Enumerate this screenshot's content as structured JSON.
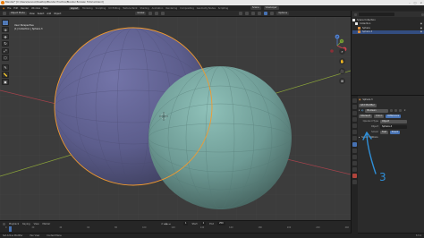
{
  "window": {
    "title": "Blender* [C:\\Users\\Lenovo\\Desktop\\Blender Practice\\Blender Boolean Tutorial.blend]",
    "controls": [
      "–",
      "□",
      "×"
    ]
  },
  "top_menu": {
    "items": [
      "File",
      "Edit",
      "Render",
      "Window",
      "Help"
    ],
    "workspaces": [
      "Layout",
      "Modeling",
      "Sculpting",
      "UV Editing",
      "Texture Paint",
      "Shading",
      "Animation",
      "Rendering",
      "Compositing",
      "Geometry Nodes",
      "Scripting"
    ],
    "active_workspace": "Layout",
    "scene": "Scene",
    "view_layer": "ViewLayer"
  },
  "viewport_header": {
    "mode": "Object Mode",
    "menus": [
      "View",
      "Select",
      "Add",
      "Object"
    ],
    "transform": "Global",
    "options": "Options"
  },
  "viewport": {
    "info_line1": "User Perspective",
    "info_line2": "(1) Collection | Sphere.3",
    "colors": {
      "background": "#3c3c3c",
      "sphere_left": "#5e5f8e",
      "sphere_right": "#6e9b95",
      "selection_outline": "#f29a2e",
      "annotation": "#2f8fd8"
    },
    "annotation_text": "3",
    "gizmo_axes": [
      "X",
      "Y",
      "Z"
    ]
  },
  "toolbar": {
    "tools": [
      "select-box-icon",
      "cursor-icon",
      "move-icon",
      "rotate-icon",
      "scale-icon",
      "transform-icon",
      "annotate-icon",
      "measure-icon",
      "add-cube-icon"
    ],
    "glyphs": [
      "⬚",
      "⊕",
      "✥",
      "↻",
      "⤢",
      "⬡",
      "✎",
      "📏",
      "▣"
    ]
  },
  "nav_buttons": [
    "⌕",
    "✋",
    "🎥",
    "⊞"
  ],
  "timeline": {
    "menus": [
      "Playback",
      "Keying",
      "View",
      "Marker"
    ],
    "ticks": [
      "0",
      "20",
      "40",
      "60",
      "80",
      "100",
      "120",
      "140",
      "160",
      "180",
      "200",
      "220",
      "240"
    ],
    "start_label": "Start",
    "start": "1",
    "end_label": "End",
    "end": "250",
    "current_frame": "1"
  },
  "status_bar": {
    "items": [
      "Set Active Modifier",
      "Pan View",
      "Context Menu"
    ],
    "version": "3.3.1"
  },
  "outliner": {
    "search_placeholder": "",
    "rows": [
      {
        "label": "Scene Collection",
        "type": "scene",
        "selected": false
      },
      {
        "label": "Collection",
        "type": "collection",
        "selected": false
      },
      {
        "label": "Sphere",
        "type": "object",
        "selected": false
      },
      {
        "label": "Sphere.3",
        "type": "object",
        "selected": true
      }
    ]
  },
  "properties": {
    "object_name": "Sphere.3",
    "modifier_dropdown": "Add Modifier",
    "modifier_name": "Boolean",
    "ops": [
      "Intersect",
      "Union",
      "Difference"
    ],
    "active_op": "Difference",
    "operand_label": "Operand Type",
    "operand_value": "Object",
    "object_label": "Object",
    "object_value": "Sphere.4",
    "solver_label": "Solver",
    "solver_values": [
      "Fast",
      "Exact"
    ],
    "active_solver": "Exact",
    "solver_options": "Solver Options"
  }
}
